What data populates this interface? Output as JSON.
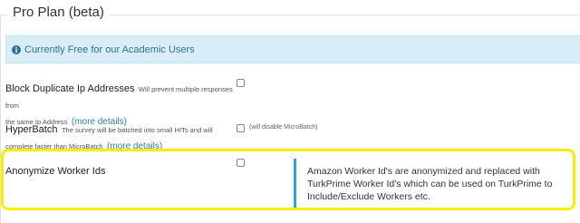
{
  "section": {
    "legend": "Pro Plan (beta)",
    "info_text": "Currently Free for our Academic Users"
  },
  "options": [
    {
      "title": "Block Duplicate Ip Addresses",
      "desc_part1": "Will prevent multiple responses from",
      "desc_part2": "the same Ip Address",
      "more_link": "more details",
      "checked": false
    },
    {
      "title": "HyperBatch",
      "desc_part1": "The survey will be batched into small HITs and will",
      "desc_part2": "complete faster than MicroBatch",
      "more_link": "more details",
      "checkbox_note": "(will disable MicroBatch)",
      "checked": false
    },
    {
      "title": "Anonymize Worker Ids",
      "checked": false,
      "callout": "Amazon Worker Id's are anonymized and replaced with TurkPrime Worker Id's which can be used on TurkPrime to Include/Exclude Workers etc."
    }
  ],
  "icons": {
    "info": "info-circle-icon"
  },
  "colors": {
    "highlight": "#f6f000",
    "callout_bar": "#31a3d6",
    "info_bg": "#d9edf7",
    "link": "#337ab7"
  }
}
